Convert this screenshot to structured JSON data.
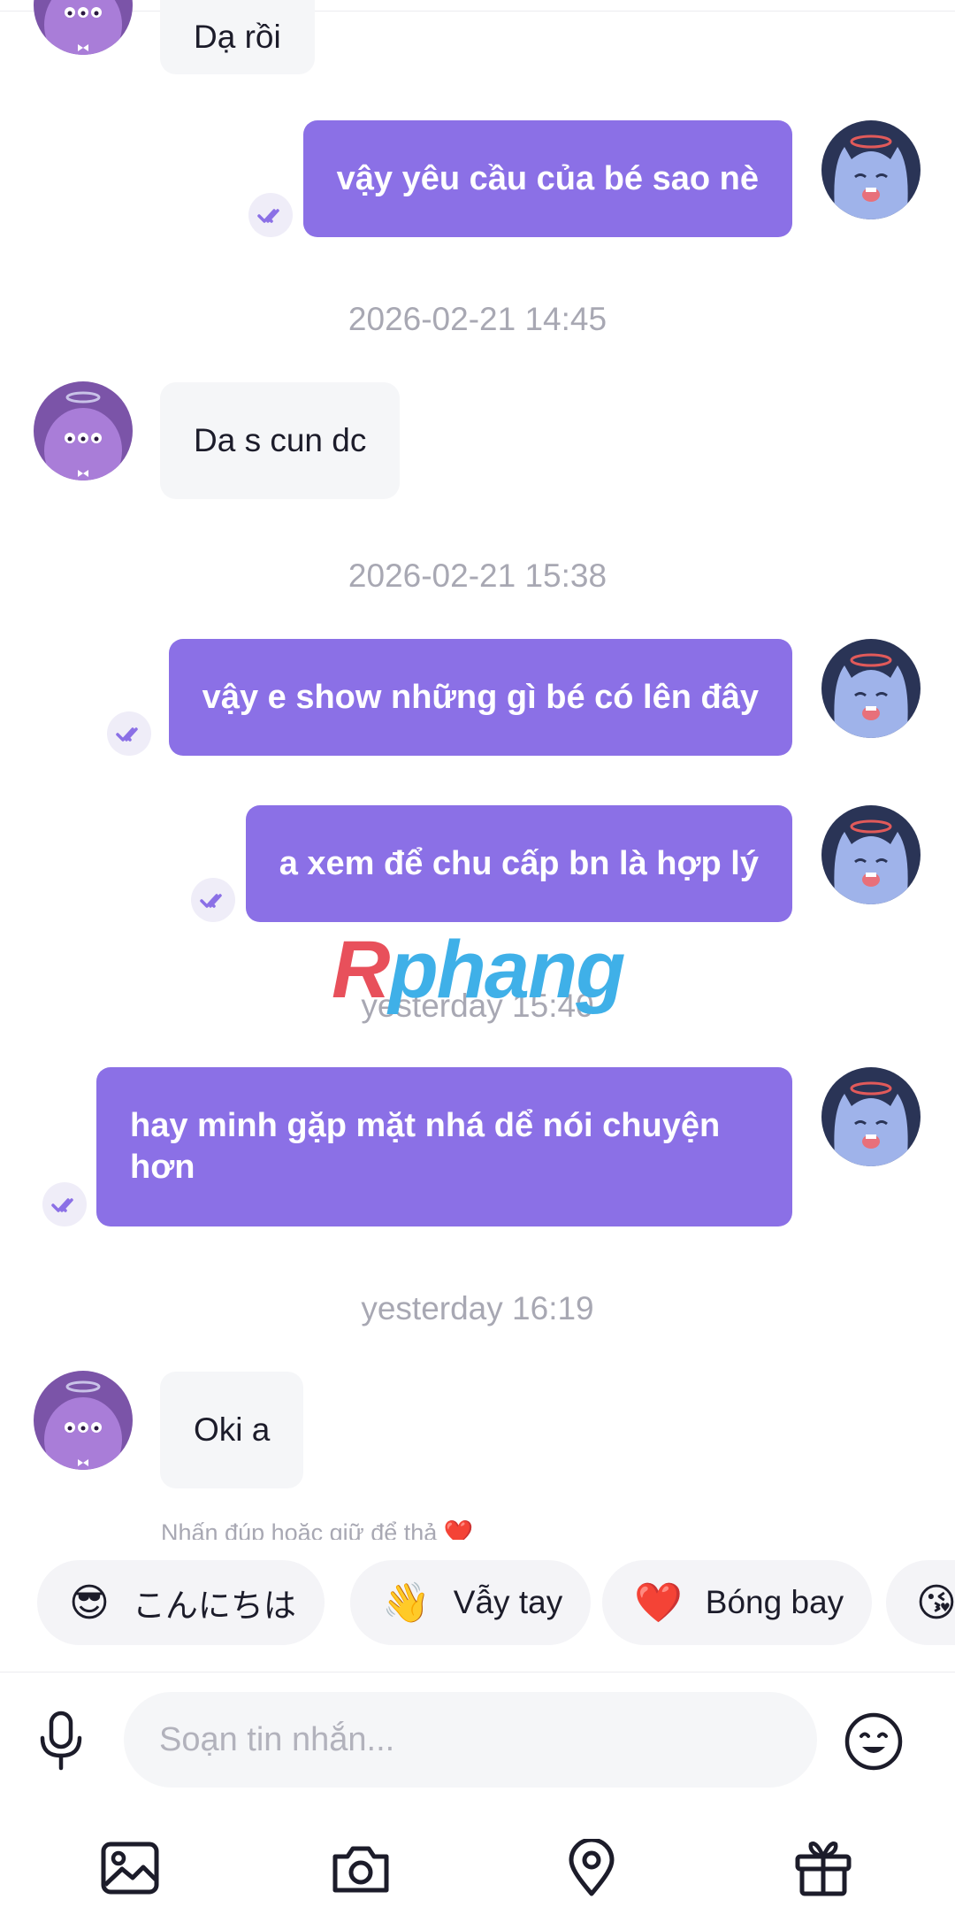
{
  "messages": [
    {
      "side": "in",
      "text": "Dạ rồi"
    },
    {
      "side": "out",
      "text": "vậy yêu cầu của bé sao nè"
    },
    {
      "type": "time",
      "text": "2026-02-21 14:45"
    },
    {
      "side": "in",
      "text": "Da s cun dc"
    },
    {
      "type": "time",
      "text": "2026-02-21 15:38"
    },
    {
      "side": "out",
      "text": "vậy e show những gì bé có lên  đây"
    },
    {
      "side": "out",
      "text": "a xem để chu cấp bn là hợp lý"
    },
    {
      "type": "time",
      "text": "yesterday 15:40"
    },
    {
      "side": "out",
      "text": "hay minh gặp mặt nhá dể nói chuyện hơn"
    },
    {
      "type": "time",
      "text": "yesterday 16:19"
    },
    {
      "side": "in",
      "text": "Oki a"
    }
  ],
  "watermark": {
    "first": "R",
    "rest": "phang"
  },
  "hint": "Nhấn đúp hoặc giữ để thả ❤️",
  "quick_replies": [
    {
      "emoji": "😎",
      "label": "こんにちは"
    },
    {
      "emoji": "👋",
      "label": "Vẫy tay"
    },
    {
      "emoji": "❤️",
      "label": "Bóng bay"
    },
    {
      "emoji": "😘",
      "label": ""
    }
  ],
  "composer": {
    "placeholder": "Soạn tin nhắn..."
  },
  "icons": {
    "mic": "microphone-icon",
    "emoji": "emoji-face-icon",
    "toolbar": [
      "image-icon",
      "camera-icon",
      "location-pin-icon",
      "gift-icon"
    ]
  },
  "colors": {
    "accent": "#8b70e6",
    "incoming_bg": "#f5f6f8",
    "timestamp": "#a8a8b3"
  }
}
